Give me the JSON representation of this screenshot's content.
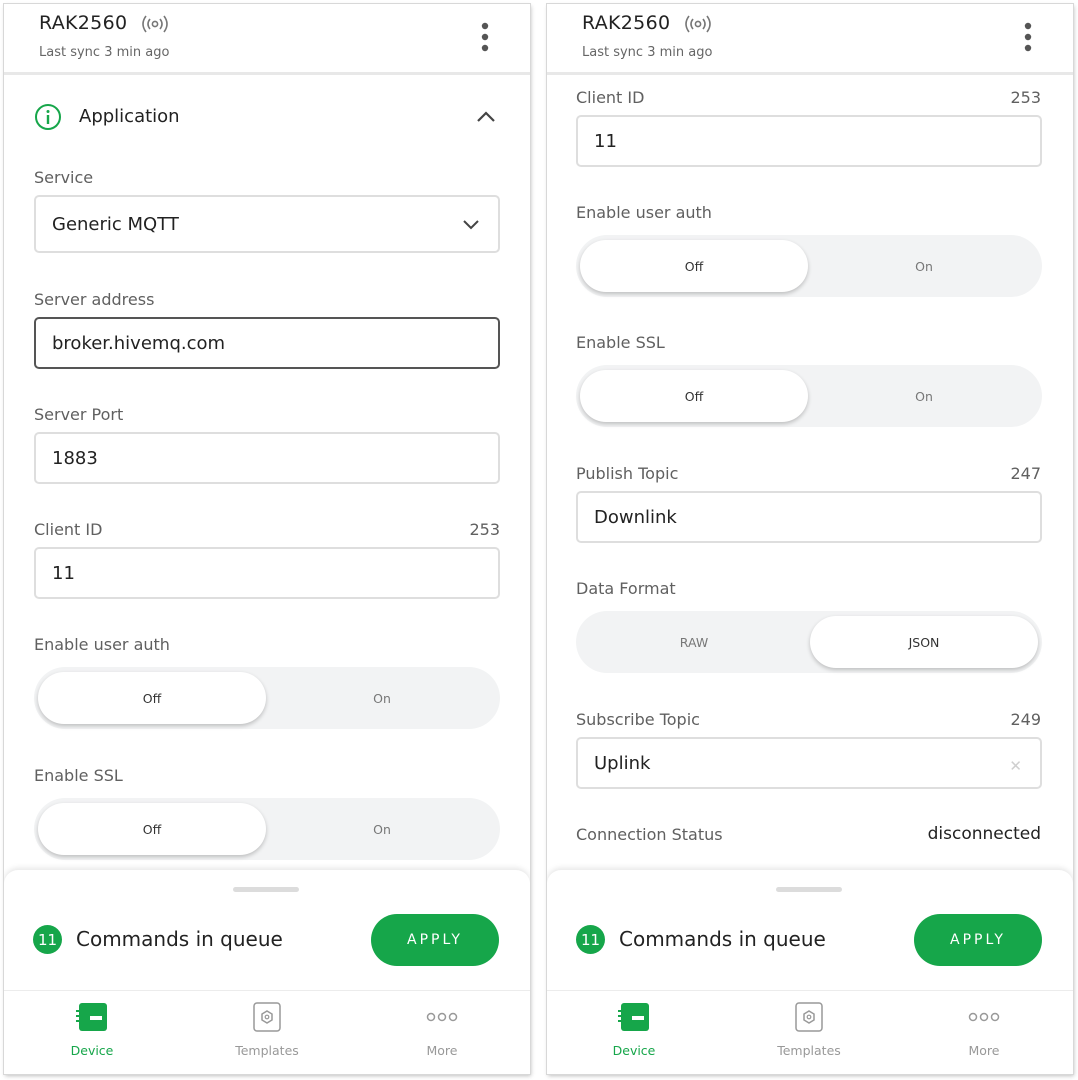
{
  "accent_color": "#16a64a",
  "header": {
    "device_name": "RAK2560",
    "signal_icon": "signal-broadcast-icon",
    "last_sync": "Last sync 3 min ago",
    "menu_icon": "more-vertical-icon"
  },
  "left": {
    "section": {
      "title": "Application",
      "icon": "info-circle-icon",
      "collapse_icon": "chevron-up-icon"
    },
    "service": {
      "label": "Service",
      "value": "Generic MQTT",
      "icon": "chevron-down-icon"
    },
    "server_address": {
      "label": "Server address",
      "value": "broker.hivemq.com"
    },
    "server_port": {
      "label": "Server Port",
      "value": "1883"
    },
    "client_id": {
      "label": "Client ID",
      "counter": "253",
      "value": "11"
    },
    "user_auth": {
      "label": "Enable user auth",
      "off": "Off",
      "on": "On",
      "selected": "Off"
    },
    "ssl": {
      "label": "Enable SSL",
      "off": "Off",
      "on": "On",
      "selected": "Off"
    }
  },
  "right": {
    "client_id": {
      "label": "Client ID",
      "counter": "253",
      "value": "11"
    },
    "user_auth": {
      "label": "Enable user auth",
      "off": "Off",
      "on": "On",
      "selected": "Off"
    },
    "ssl": {
      "label": "Enable SSL",
      "off": "Off",
      "on": "On",
      "selected": "Off"
    },
    "publish_topic": {
      "label": "Publish Topic",
      "counter": "247",
      "value": "Downlink"
    },
    "data_format": {
      "label": "Data Format",
      "raw": "RAW",
      "json": "JSON",
      "selected": "JSON"
    },
    "subscribe_topic": {
      "label": "Subscribe Topic",
      "counter": "249",
      "value": "Uplink",
      "clear_icon": "close-icon"
    },
    "connection_status": {
      "label": "Connection Status",
      "value": "disconnected"
    }
  },
  "queue": {
    "count": "11",
    "text": "Commands in queue",
    "apply": "APPLY"
  },
  "nav": [
    {
      "label": "Device",
      "icon": "device-board-icon",
      "active": true
    },
    {
      "label": "Templates",
      "icon": "templates-icon",
      "active": false
    },
    {
      "label": "More",
      "icon": "more-horizontal-icon",
      "active": false
    }
  ]
}
